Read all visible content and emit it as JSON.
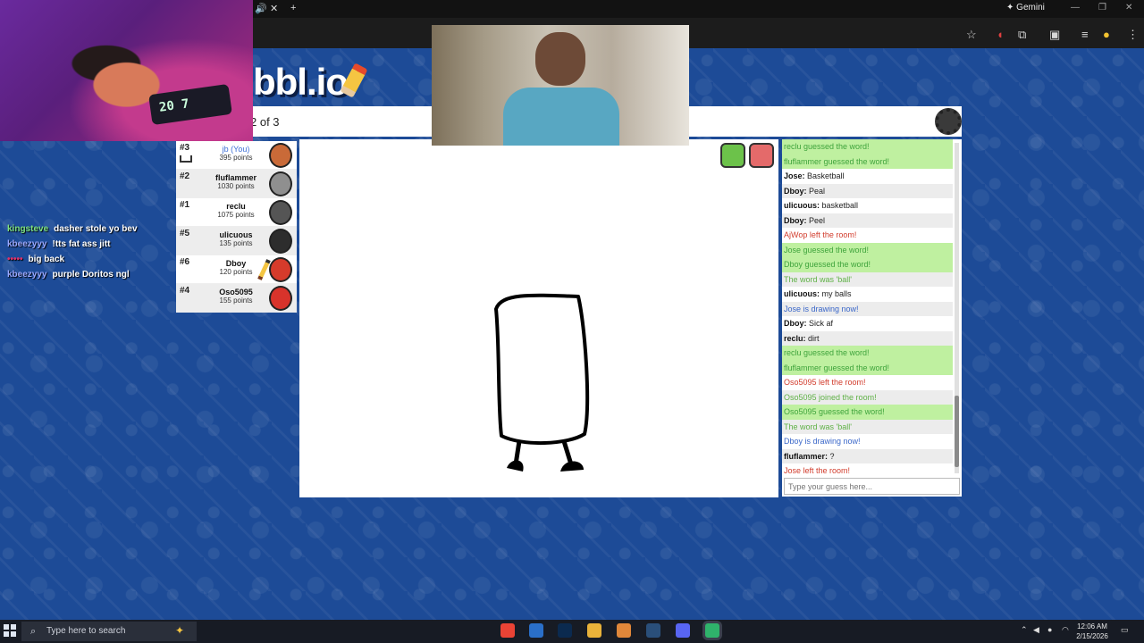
{
  "browser": {
    "tab_icons": [
      "speaker-icon",
      "close-icon",
      "plus-icon"
    ],
    "gemini_label": "Gemini",
    "window_controls": [
      "minimize-icon",
      "restore-icon",
      "close-icon"
    ]
  },
  "game": {
    "logo_text": "bbl.io",
    "round_text": "2 of 3",
    "players": [
      {
        "rank": "#3",
        "name": "jb (You)",
        "points": "395 points",
        "avatar_color": "#c96a38",
        "is_self": true,
        "has_crown": true,
        "is_drawing": false
      },
      {
        "rank": "#2",
        "name": "fluflammer",
        "points": "1030 points",
        "avatar_color": "#8f8f8f",
        "is_self": false,
        "has_crown": false,
        "is_drawing": false
      },
      {
        "rank": "#1",
        "name": "reclu",
        "points": "1075 points",
        "avatar_color": "#555555",
        "is_self": false,
        "has_crown": false,
        "is_drawing": false
      },
      {
        "rank": "#5",
        "name": "ulicuous",
        "points": "135 points",
        "avatar_color": "#2d2d2d",
        "is_self": false,
        "has_crown": false,
        "is_drawing": false
      },
      {
        "rank": "#6",
        "name": "Dboy",
        "points": "120 points",
        "avatar_color": "#d63b2b",
        "is_self": false,
        "has_crown": false,
        "is_drawing": true
      },
      {
        "rank": "#4",
        "name": "Oso5095",
        "points": "155 points",
        "avatar_color": "#d8332b",
        "is_self": false,
        "has_crown": false,
        "is_drawing": false
      }
    ],
    "chat": [
      {
        "user": "",
        "text": "reclu guessed the word!",
        "kind": "ok"
      },
      {
        "user": "",
        "text": "fluflammer guessed the word!",
        "kind": "ok"
      },
      {
        "user": "Jose:",
        "text": "Basketball",
        "kind": "user"
      },
      {
        "user": "Dboy:",
        "text": "Peal",
        "kind": "user"
      },
      {
        "user": "ulicuous:",
        "text": "basketball",
        "kind": "user"
      },
      {
        "user": "Dboy:",
        "text": "Peel",
        "kind": "user"
      },
      {
        "user": "",
        "text": "AjWop left the room!",
        "kind": "red"
      },
      {
        "user": "",
        "text": "Jose guessed the word!",
        "kind": "ok"
      },
      {
        "user": "",
        "text": "Dboy guessed the word!",
        "kind": "ok"
      },
      {
        "user": "",
        "text": "The word was 'ball'",
        "kind": "info"
      },
      {
        "user": "ulicuous:",
        "text": "my balls",
        "kind": "user"
      },
      {
        "user": "",
        "text": "Jose is drawing now!",
        "kind": "blue"
      },
      {
        "user": "Dboy:",
        "text": "Sick af",
        "kind": "user"
      },
      {
        "user": "reclu:",
        "text": "dirt",
        "kind": "user"
      },
      {
        "user": "",
        "text": "reclu guessed the word!",
        "kind": "ok"
      },
      {
        "user": "",
        "text": "fluflammer guessed the word!",
        "kind": "ok"
      },
      {
        "user": "",
        "text": "Oso5095 left the room!",
        "kind": "red"
      },
      {
        "user": "",
        "text": "Oso5095 joined the room!",
        "kind": "info"
      },
      {
        "user": "",
        "text": "Oso5095 guessed the word!",
        "kind": "ok"
      },
      {
        "user": "",
        "text": "The word was 'ball'",
        "kind": "info"
      },
      {
        "user": "",
        "text": "Dboy is drawing now!",
        "kind": "blue"
      },
      {
        "user": "fluflammer:",
        "text": "?",
        "kind": "user"
      },
      {
        "user": "",
        "text": "Jose left the room!",
        "kind": "red"
      }
    ],
    "guess_placeholder": "Type your guess here...",
    "like_color": "#6cc24a",
    "dislike_color": "#e46a6a"
  },
  "stream_chat": [
    {
      "user": "kingsteve",
      "text": "dasher stole yo bev",
      "color": "#7fe37f"
    },
    {
      "user": "kbeezyyy",
      "text": "!tts fat ass jitt",
      "color": "#9aa8ff"
    },
    {
      "user": "",
      "text": "big back",
      "color": "#e0326a"
    },
    {
      "user": "kbeezyyy",
      "text": "purple Doritos ngl",
      "color": "#9aa8ff"
    }
  ],
  "taskbar": {
    "search_placeholder": "Type here to search",
    "apps": [
      {
        "name": "chrome-icon",
        "color": "#ea4335"
      },
      {
        "name": "vs-icon",
        "color": "#2a6fc9"
      },
      {
        "name": "photoshop-icon",
        "color": "#0b2a4f"
      },
      {
        "name": "file-explorer-icon",
        "color": "#e9b23a"
      },
      {
        "name": "paint-icon",
        "color": "#e0873a"
      },
      {
        "name": "steam-icon",
        "color": "#2a4f7a"
      },
      {
        "name": "discord-icon",
        "color": "#5865f2"
      },
      {
        "name": "game-icon",
        "color": "#2fb36b"
      }
    ],
    "time": "12:06 AM",
    "date": "2/15/2026"
  }
}
